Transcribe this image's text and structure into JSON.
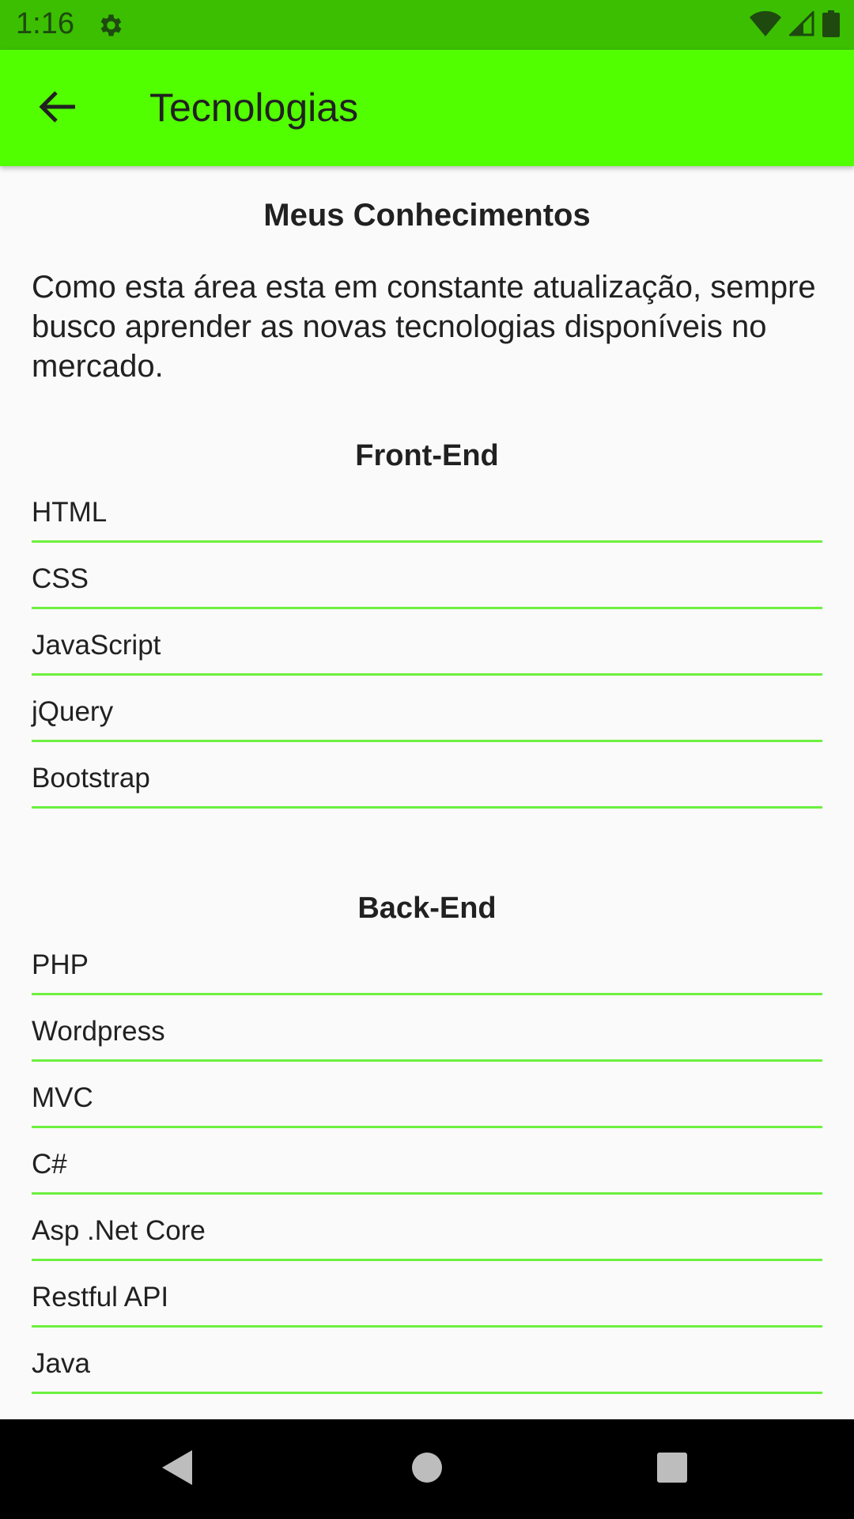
{
  "status_bar": {
    "time": "1:16"
  },
  "app_bar": {
    "title": "Tecnologias"
  },
  "main": {
    "title": "Meus Conhecimentos",
    "intro": "Como esta área esta em constante atualização, sempre busco aprender as novas tecnologias disponíveis no mercado."
  },
  "front_end": {
    "title": "Front-End",
    "items": [
      "HTML",
      "CSS",
      "JavaScript",
      "jQuery",
      "Bootstrap"
    ]
  },
  "back_end": {
    "title": "Back-End",
    "items": [
      "PHP",
      "Wordpress",
      "MVC",
      "C#",
      "Asp .Net Core",
      "Restful API",
      "Java"
    ]
  },
  "colors": {
    "status_bar": "#3bbf00",
    "app_bar": "#52ff00",
    "underline": "#6df03f"
  },
  "icons": [
    "gear-icon",
    "wifi-icon",
    "signal-icon",
    "battery-icon",
    "back-arrow-icon",
    "nav-back-icon",
    "nav-home-icon",
    "nav-recents-icon"
  ]
}
